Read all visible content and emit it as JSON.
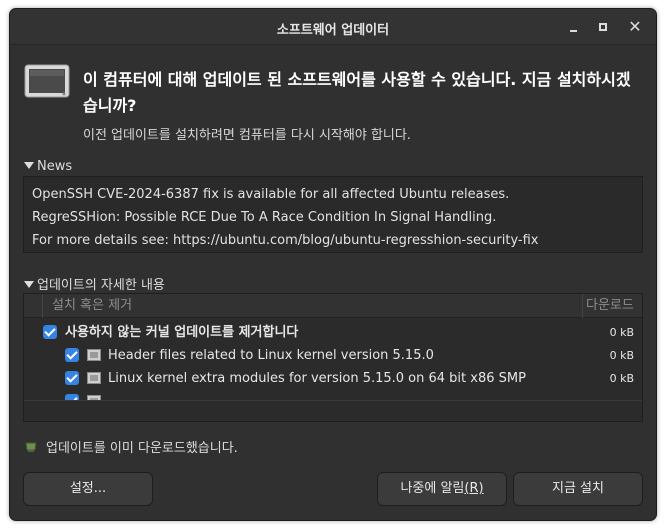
{
  "window": {
    "title": "소프트웨어 업데이터",
    "controls": {
      "minimize": "minimize",
      "maximize": "maximize",
      "close": "✕"
    }
  },
  "header": {
    "heading": "이 컴퓨터에 대해 업데이트 된 소프트웨어를 사용할 수 있습니다. 지금 설치하시겠습니까?",
    "subtext": "이전 업데이트를 설치하려면 컴퓨터를 다시 시작해야 합니다.",
    "icon": "computer-icon"
  },
  "news": {
    "expander_label": "News",
    "lines": [
      "OpenSSH CVE-2024-6387 fix is available for all affected Ubuntu releases.",
      "RegreSSHion: Possible RCE Due To A Race Condition In Signal Handling.",
      "For more details see: https://ubuntu.com/blog/ubuntu-regresshion-security-fix"
    ]
  },
  "details": {
    "expander_label": "업데이트의 자세한 내용",
    "columns": [
      "설치 혹은 제거",
      "다운로드"
    ],
    "rows": [
      {
        "label": "사용하지 않는 커널 업데이트를 제거합니다",
        "size": "0 kB",
        "checked": true,
        "level": 0
      },
      {
        "label": "Header files related to Linux kernel version 5.15.0",
        "size": "0 kB",
        "checked": true,
        "level": 1
      },
      {
        "label": "Linux kernel extra modules for version 5.15.0 on 64 bit x86 SMP",
        "size": "0 kB",
        "checked": true,
        "level": 1
      }
    ]
  },
  "status": {
    "text": "업데이트를 이미 다운로드했습니다."
  },
  "buttons": {
    "settings": "설정...",
    "later": "나중에 알림",
    "later_mnemonic": "(R)",
    "install_now": "지금 설치"
  },
  "colors": {
    "window_bg": "#303030",
    "checkbox": "#3584e4"
  }
}
